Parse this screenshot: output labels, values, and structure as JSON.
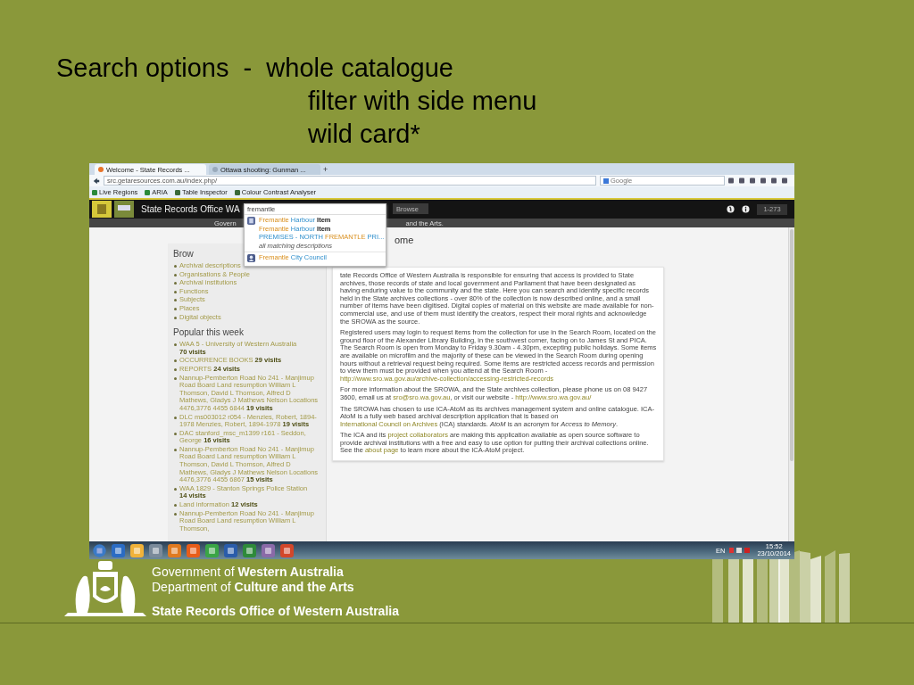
{
  "slide": {
    "title_lines": [
      "Search options  -  whole catalogue",
      "filter with side menu",
      "wild card*"
    ]
  },
  "browser": {
    "tabs": [
      {
        "label": "Welcome - State Records ...",
        "selected": true
      },
      {
        "label": "Ottawa shooting: Gunman ...",
        "selected": false
      }
    ],
    "new_tab": "+",
    "address": "src.getaresources.com.au/index.php/",
    "search_placeholder": "Google",
    "bookmarks": [
      "Live Regions",
      "ARIA",
      "Table Inspector",
      "Colour Contrast Analyser"
    ]
  },
  "site": {
    "title": "State Records Office WA",
    "browse_button": "Browse",
    "page_range": "1-273",
    "nav_left": "Govern",
    "nav_right": "and the Arts.",
    "search": {
      "value": "fremantle",
      "groups": [
        {
          "kind": "description",
          "items": [
            [
              {
                "text": "Fremantle",
                "kind": "match"
              },
              {
                "text": "Harbour",
                "kind": "link"
              },
              {
                "text": "Item",
                "kind": "level"
              }
            ],
            [
              {
                "text": "Fremantle",
                "kind": "match"
              },
              {
                "text": "Harbour",
                "kind": "link"
              },
              {
                "text": "Item",
                "kind": "level"
              }
            ],
            [
              {
                "text": "PREMISES - NORTH",
                "kind": "link"
              },
              {
                "text": "FREMANTLE",
                "kind": "match"
              },
              {
                "text": "PRI...",
                "kind": "link"
              }
            ]
          ],
          "more": "all matching descriptions"
        },
        {
          "kind": "actor",
          "items": [
            [
              {
                "text": "Fremantle",
                "kind": "match"
              },
              {
                "text": "City Council",
                "kind": "link"
              }
            ]
          ]
        }
      ]
    }
  },
  "sidebar": {
    "browse_heading": "Brow",
    "browse_links": [
      "Archival descriptions",
      "Organisations & People",
      "Archival institutions",
      "Functions",
      "Subjects",
      "Places",
      "Digital objects"
    ],
    "popular_heading": "Popular this week",
    "popular": [
      {
        "title": "WAA 5 - University of Western Australia",
        "visits": "70 visits"
      },
      {
        "title": "OCCURRENCE BOOKS",
        "visits": "29 visits"
      },
      {
        "title": "REPORTS",
        "visits": "24 visits"
      },
      {
        "title": "Nannup-Pemberton Road No 241 - Manjimup Road Board Land resumption William L Thomson, David L Thomson, Alfred D Mathews, Gladys J Mathews Nelson Locations 4476,3776 4455 6844",
        "visits": "19 visits"
      },
      {
        "title": "DLC ms003012 r054 - Menzies, Robert, 1894-1978 Menzies, Robert, 1894-1978",
        "visits": "19 visits"
      },
      {
        "title": "DAC stanford_msc_m1399 r161 - Seddon, George",
        "visits": "16 visits"
      },
      {
        "title": "Nannup-Pemberton Road No 241 - Manjimup Road Board Land resumption William L Thomson, David L Thomson, Alfred D Mathews, Gladys J Mathews Nelson Locations 4476,3776 4455 6867",
        "visits": "15 visits"
      },
      {
        "title": "WAA 1829 - Stanton Springs Police Station",
        "visits": "14 visits"
      },
      {
        "title": "Land information",
        "visits": "12 visits"
      },
      {
        "title": "Nannup-Pemberton Road No 241 - Manjimup Road Board Land resumption William L Thomson,"
      }
    ]
  },
  "main": {
    "heading": "ome",
    "paragraphs": [
      [
        {
          "kind": "text",
          "text": "tate Records Office of Western Australia is responsible for ensuring that access is provided to State archives, those records of state and local government and Parliament that have been designated as having enduring value to the community and the state. Here you can search and identify specific records held in the State archives collections - over 80% of the collection is now described online, and a small number of items have been digitised. Digital copies of material on this website are made available for non-commercial use, and use of them must identify the creators, respect their moral rights and acknowledge the SROWA as the source."
        }
      ],
      [
        {
          "kind": "text",
          "text": "Registered users may login to request items from the collection for use in the Search Room, located on the ground floor of the Alexander Library Building, in the southwest corner, facing on to James St and PICA. The Search Room is open from Monday to Friday 9.30am - 4.30pm, excepting public holidays. Some items are available on microfilm and the majority of these can be viewed in the Search Room during opening hours without a retrieval request being required. Some items are restricted access records and permission to view them must be provided when you attend at the Search Room - "
        },
        {
          "kind": "link",
          "text": "http://www.sro.wa.gov.au/archive-collection/accessing-restricted-records"
        }
      ],
      [
        {
          "kind": "text",
          "text": "For more information about the SROWA, and the State archives collection, please phone us on 08 9427 3600, email us at "
        },
        {
          "kind": "link",
          "text": "sro@sro.wa.gov.au"
        },
        {
          "kind": "text",
          "text": ", or visit our website - "
        },
        {
          "kind": "link",
          "text": "http://www.sro.wa.gov.au/"
        }
      ],
      [
        {
          "kind": "text",
          "text": "The SROWA has chosen to use ICA-AtoM as its archives management system and online catalogue. ICA-AtoM is a fully web based archival description application that is based on "
        },
        {
          "kind": "link",
          "text": "International Council on Archives"
        },
        {
          "kind": "text",
          "text": " (ICA) standards. *AtoM* is an acronym for *Access to Memory*."
        }
      ],
      [
        {
          "kind": "text",
          "text": "The ICA and its "
        },
        {
          "kind": "link",
          "text": "project collaborators"
        },
        {
          "kind": "text",
          "text": " are making this application available as open source software to provide archival institutions with a free and easy to use option for putting their archival collections online. See the "
        },
        {
          "kind": "link",
          "text": "about page"
        },
        {
          "kind": "text",
          "text": " to learn more about the ICA-AtoM project."
        }
      ]
    ]
  },
  "taskbar": {
    "language": "EN",
    "time": "15:52",
    "date": "23/10/2014"
  },
  "footer": {
    "lines": [
      "Government of **Western Australia**",
      "Department of **Culture and the Arts**"
    ],
    "title": "State Records Office of Western Australia"
  }
}
